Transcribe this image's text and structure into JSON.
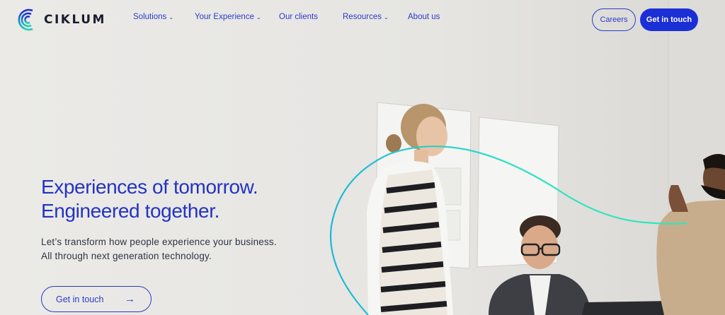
{
  "brand": {
    "name": "CIKLUM"
  },
  "nav": {
    "items": [
      {
        "label": "Solutions",
        "has_dropdown": true
      },
      {
        "label": "Your Experience",
        "has_dropdown": true
      },
      {
        "label": "Our clients",
        "has_dropdown": false
      },
      {
        "label": "Resources",
        "has_dropdown": true
      },
      {
        "label": "About us",
        "has_dropdown": false
      }
    ]
  },
  "header": {
    "careers_label": "Careers",
    "contact_label": "Get in touch"
  },
  "hero": {
    "headline_line1": "Experiences of tomorrow.",
    "headline_line2": "Engineered together.",
    "subtext_line1": "Let’s transform how people experience your business.",
    "subtext_line2": "All through next generation technology.",
    "cta_label": "Get in touch",
    "cta_icon": "arrow-right-icon"
  },
  "colors": {
    "accent": "#1b2fd6",
    "link": "#2a3bc7",
    "logo_gradient": [
      "#1fd1b5",
      "#1b2fd6"
    ],
    "curve": "#2fe0c4"
  }
}
